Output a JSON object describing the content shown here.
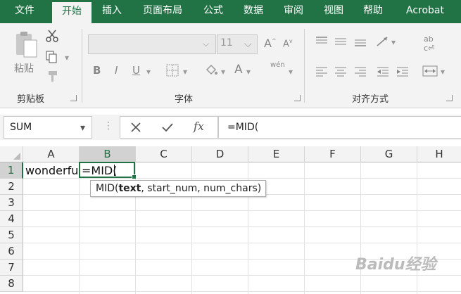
{
  "ribbon_tabs": [
    "文件",
    "开始",
    "插入",
    "页面布局",
    "公式",
    "数据",
    "审阅",
    "视图",
    "帮助",
    "Acrobat"
  ],
  "active_tab": "开始",
  "groups": {
    "clipboard": "剪贴板",
    "font": "字体",
    "alignment": "对齐方式"
  },
  "clipboard": {
    "paste_label": "粘贴"
  },
  "font": {
    "size_value": "11",
    "bold": "B",
    "italic": "I",
    "underline": "U",
    "font_color_glyph": "A",
    "phonetic": "wén"
  },
  "formula_bar": {
    "name_box": "SUM",
    "formula": "=MID("
  },
  "columns": [
    "A",
    "B",
    "C",
    "D",
    "E",
    "F",
    "G",
    "H"
  ],
  "rows": [
    "1",
    "2",
    "3",
    "4",
    "5",
    "6",
    "7",
    "8"
  ],
  "cells": {
    "A1": "wonderful",
    "B1": "=MID("
  },
  "tooltip": {
    "func": "MID(",
    "arg_bold": "text",
    "rest": ", start_num, num_chars)"
  },
  "watermark": "Baidu经验",
  "colors": {
    "accent": "#217346"
  }
}
